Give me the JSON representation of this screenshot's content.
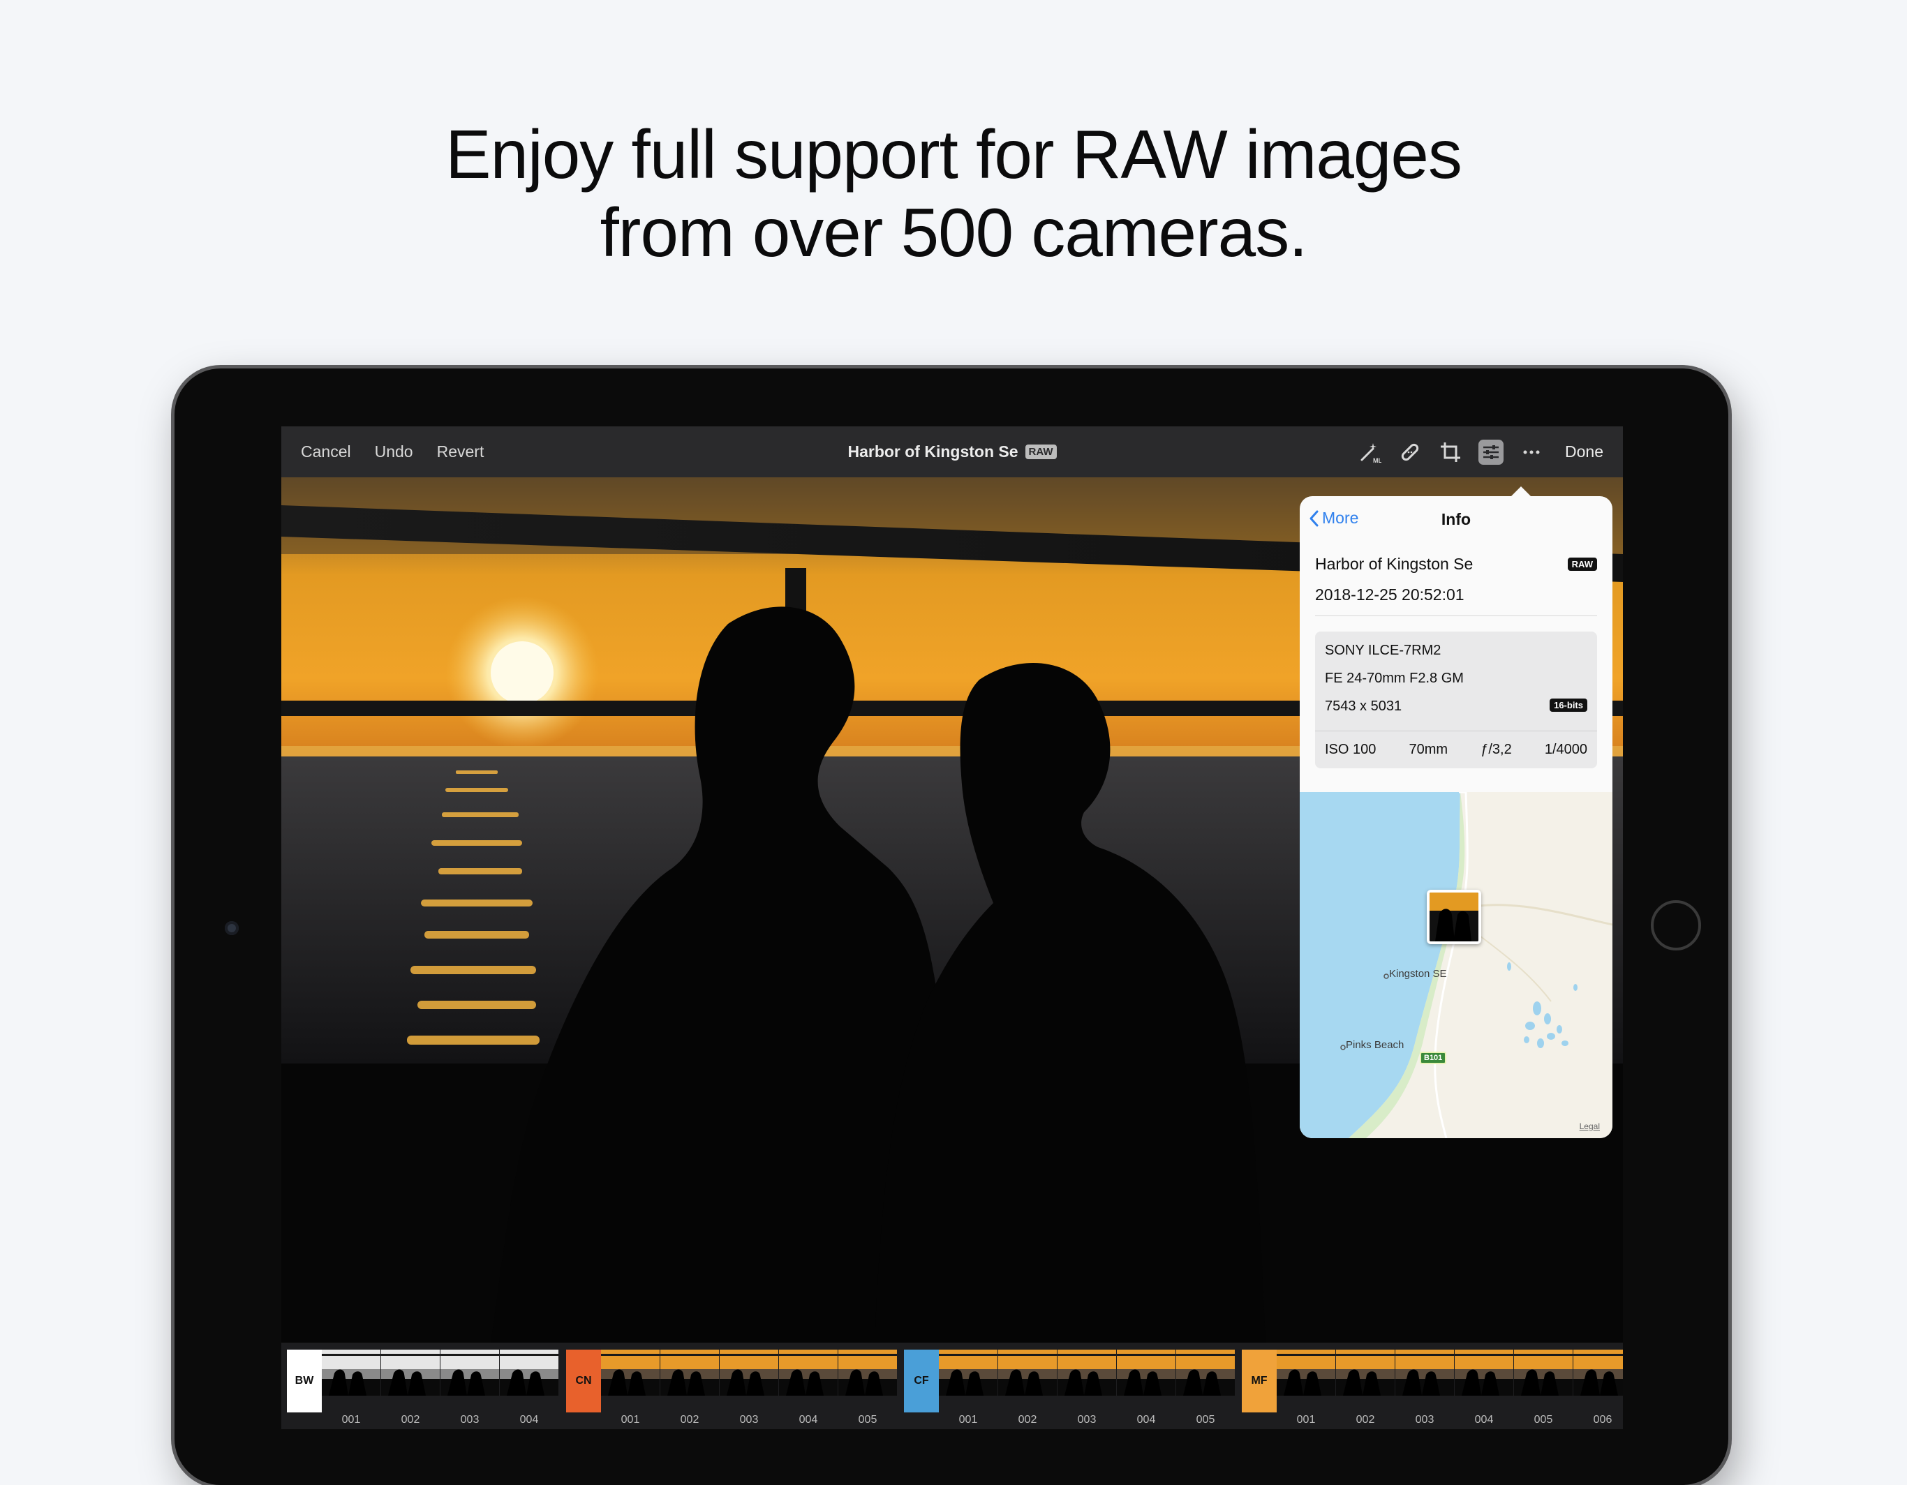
{
  "headline": {
    "line1": "Enjoy full support for RAW images",
    "line2": "from over 500 cameras."
  },
  "toolbar": {
    "cancel": "Cancel",
    "undo": "Undo",
    "revert": "Revert",
    "title": "Harbor of Kingston Se",
    "raw_badge": "RAW",
    "tools": [
      "magic-wand-ml-icon",
      "bandage-icon",
      "crop-icon",
      "sliders-icon",
      "more-icon"
    ],
    "ml_label": "ML",
    "done": "Done"
  },
  "info": {
    "back_label": "More",
    "title": "Info",
    "name": "Harbor of Kingston Se",
    "raw_badge": "RAW",
    "date": "2018-12-25 20:52:01",
    "camera": "SONY ILCE-7RM2",
    "lens": "FE 24-70mm F2.8 GM",
    "resolution": "7543 x 5031",
    "bits_badge": "16-bits",
    "iso": "ISO 100",
    "focal": "70mm",
    "aperture": "ƒ/3,2",
    "shutter": "1/4000",
    "map": {
      "town": "Kingston SE",
      "beach": "Pinks Beach",
      "road": "B101",
      "legal": "Legal"
    }
  },
  "filmstrip": [
    {
      "label": "BW",
      "color": "#ffffff",
      "text_color": "#111111",
      "tone": "bw",
      "items": [
        "001",
        "002",
        "003",
        "004"
      ]
    },
    {
      "label": "CN",
      "color": "#e8612c",
      "text_color": "#111111",
      "tone": "warm",
      "items": [
        "001",
        "002",
        "003",
        "004",
        "005"
      ]
    },
    {
      "label": "CF",
      "color": "#4a9fd8",
      "text_color": "#111111",
      "tone": "warm",
      "items": [
        "001",
        "002",
        "003",
        "004",
        "005"
      ]
    },
    {
      "label": "MF",
      "color": "#f0a23a",
      "text_color": "#111111",
      "tone": "warm",
      "items": [
        "001",
        "002",
        "003",
        "004",
        "005",
        "006"
      ]
    }
  ],
  "colors": {
    "background": "#f4f6f9",
    "accent": "#2f80ed",
    "toolbar": "#2a2a2c"
  }
}
